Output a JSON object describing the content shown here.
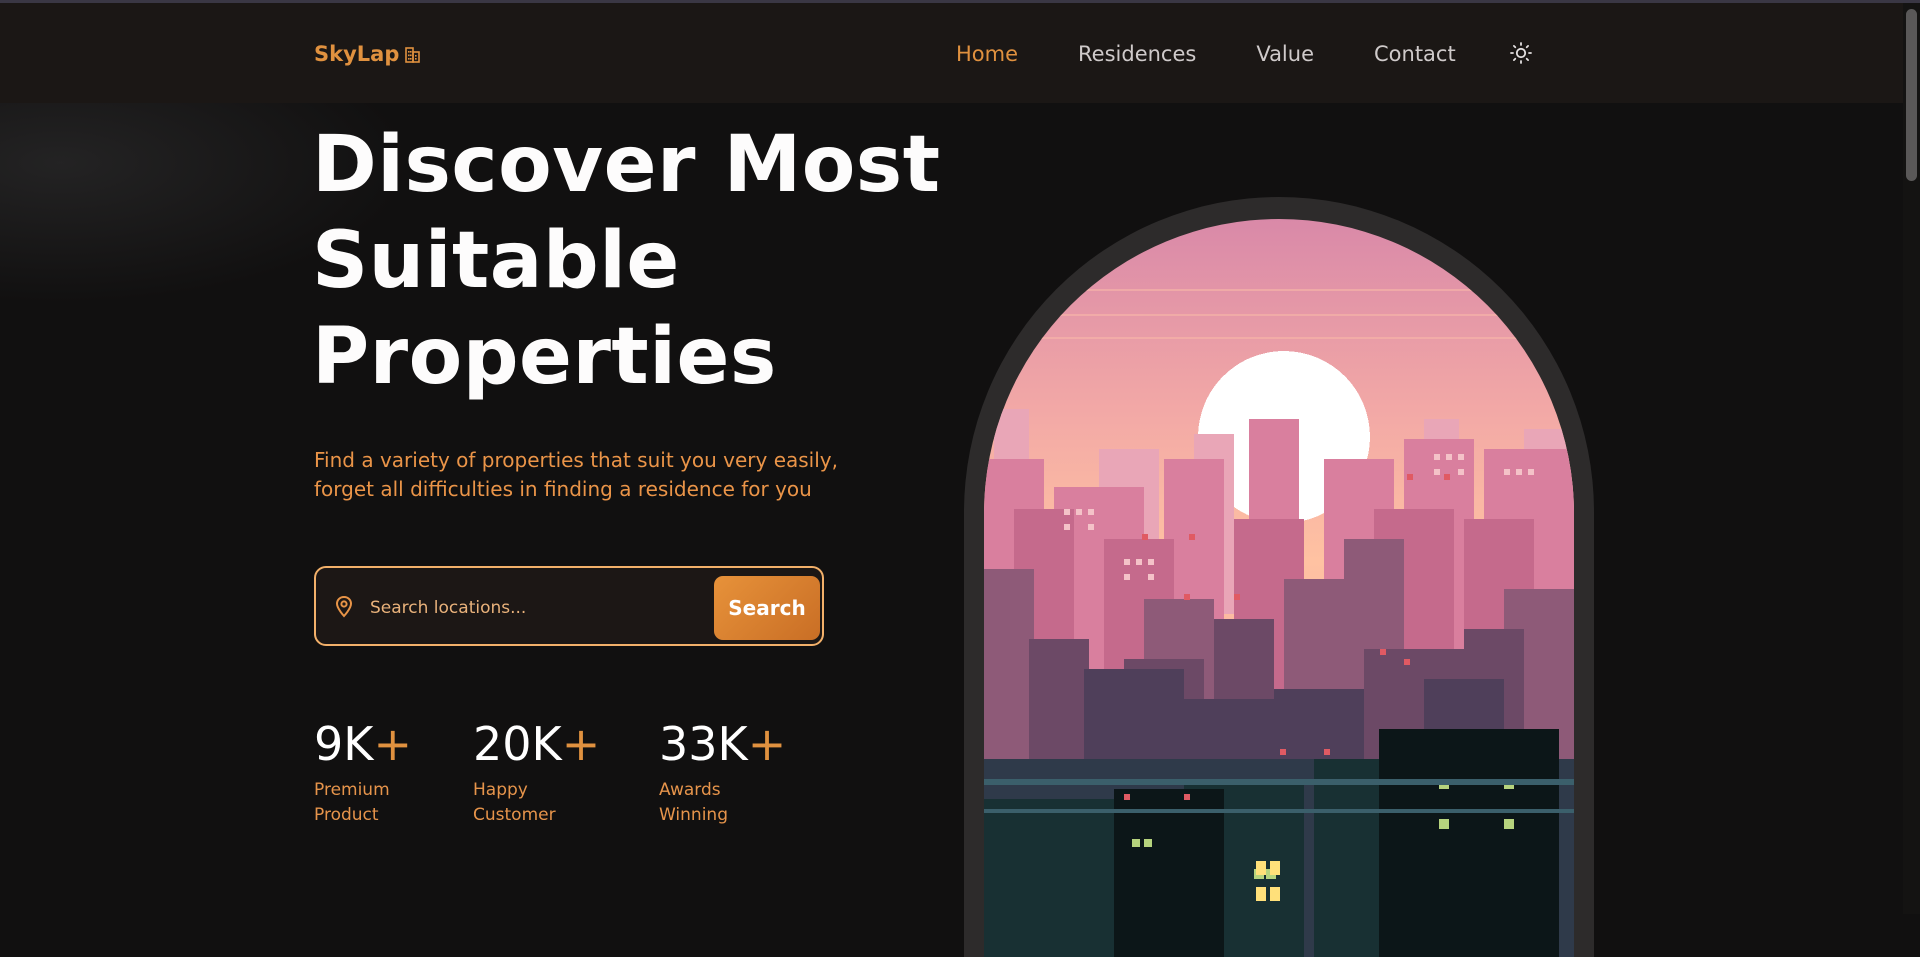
{
  "brand": {
    "name": "SkyLap",
    "icon": "building-icon"
  },
  "nav": {
    "items": [
      {
        "label": "Home",
        "active": true
      },
      {
        "label": "Residences",
        "active": false
      },
      {
        "label": "Value",
        "active": false
      },
      {
        "label": "Contact",
        "active": false
      }
    ],
    "theme_toggle_icon": "sun-icon"
  },
  "hero": {
    "title_lines": [
      "Discover Most",
      "Suitable",
      "Properties"
    ],
    "subtitle_lines": [
      "Find a variety of properties that suit you very easily,",
      "forget all difficulties in finding a residence for you"
    ]
  },
  "search": {
    "icon": "location-pin-icon",
    "placeholder": "Search locations...",
    "value": "",
    "button_label": "Search"
  },
  "stats": [
    {
      "value": "9K",
      "suffix": "+",
      "label_lines": [
        "Premium",
        "Product"
      ]
    },
    {
      "value": "20K",
      "suffix": "+",
      "label_lines": [
        "Happy",
        "Customer"
      ]
    },
    {
      "value": "33K",
      "suffix": "+",
      "label_lines": [
        "Awards",
        "Winning"
      ]
    }
  ],
  "hero_image": {
    "description_icon": "pixel-city-illustration"
  },
  "colors": {
    "accent": "#e0913f",
    "background": "#111010",
    "header": "#1b1715",
    "text": "#ffffff",
    "subtext": "#ea9448"
  }
}
